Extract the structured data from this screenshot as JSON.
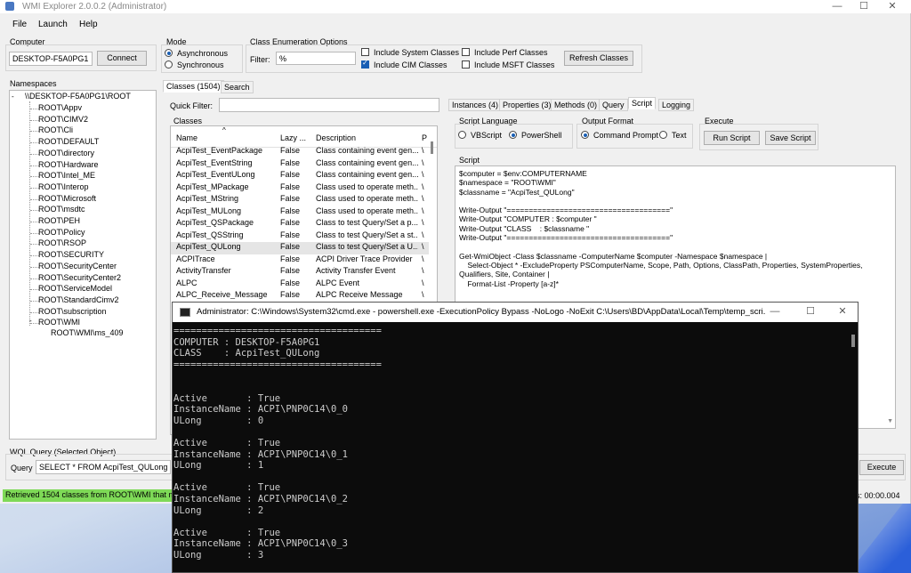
{
  "window": {
    "title": "WMI Explorer 2.0.0.2 (Administrator)",
    "min": "—",
    "max": "☐",
    "close": "✕"
  },
  "menu": [
    "File",
    "Launch",
    "Help"
  ],
  "computer": {
    "label": "Computer",
    "value": "DESKTOP-F5A0PG1",
    "connect": "Connect"
  },
  "mode": {
    "label": "Mode",
    "options": [
      "Asynchronous",
      "Synchronous"
    ],
    "selected": "Asynchronous"
  },
  "enum": {
    "label": "Class Enumeration Options",
    "filter_label": "Filter:",
    "filter_value": "%",
    "checks": [
      {
        "label": "Include System Classes",
        "checked": false
      },
      {
        "label": "Include Perf Classes",
        "checked": false
      },
      {
        "label": "Include CIM Classes",
        "checked": true
      },
      {
        "label": "Include MSFT Classes",
        "checked": false
      }
    ],
    "refresh": "Refresh Classes"
  },
  "namespaces": {
    "label": "Namespaces",
    "root": "\\\\DESKTOP-F5A0PG1\\ROOT",
    "collapse": "-",
    "items": [
      "ROOT\\Appv",
      "ROOT\\CIMV2",
      "ROOT\\Cli",
      "ROOT\\DEFAULT",
      "ROOT\\directory",
      "ROOT\\Hardware",
      "ROOT\\Intel_ME",
      "ROOT\\Interop",
      "ROOT\\Microsoft",
      "ROOT\\msdtc",
      "ROOT\\PEH",
      "ROOT\\Policy",
      "ROOT\\RSOP",
      "ROOT\\SECURITY",
      "ROOT\\SecurityCenter",
      "ROOT\\SecurityCenter2",
      "ROOT\\ServiceModel",
      "ROOT\\StandardCimv2",
      "ROOT\\subscription",
      "ROOT\\WMI"
    ],
    "child": "ROOT\\WMI\\ms_409"
  },
  "class_tabs": [
    "Classes (1504)",
    "Search"
  ],
  "quick_filter": {
    "label": "Quick Filter:",
    "value": ""
  },
  "classes": {
    "label": "Classes",
    "columns": [
      "Name",
      "Lazy ...",
      "Description",
      "P"
    ],
    "rows": [
      [
        "AcpiTest_EventPackage",
        "False",
        "Class containing event gen...",
        "\\"
      ],
      [
        "AcpiTest_EventString",
        "False",
        "Class containing event gen...",
        "\\"
      ],
      [
        "AcpiTest_EventULong",
        "False",
        "Class containing event gen...",
        "\\"
      ],
      [
        "AcpiTest_MPackage",
        "False",
        "Class used to operate meth...",
        "\\"
      ],
      [
        "AcpiTest_MString",
        "False",
        "Class used to operate meth...",
        "\\"
      ],
      [
        "AcpiTest_MULong",
        "False",
        "Class used to operate meth...",
        "\\"
      ],
      [
        "AcpiTest_QSPackage",
        "False",
        "Class to test Query/Set a p...",
        "\\"
      ],
      [
        "AcpiTest_QSString",
        "False",
        "Class to test Query/Set a st...",
        "\\"
      ],
      [
        "AcpiTest_QULong",
        "False",
        "Class to test Query/Set a U...",
        "\\"
      ],
      [
        "ACPITrace",
        "False",
        "ACPI Driver Trace Provider",
        "\\"
      ],
      [
        "ActivityTransfer",
        "False",
        "Activity Transfer Event",
        "\\"
      ],
      [
        "ALPC",
        "False",
        "ALPC Event",
        "\\"
      ],
      [
        "ALPC_Receive_Message",
        "False",
        "ALPC Receive Message",
        "\\"
      ]
    ],
    "selected_index": 8
  },
  "right_tabs": [
    "Instances (4)",
    "Properties (3)",
    "Methods (0)",
    "Query",
    "Script",
    "Logging"
  ],
  "right_active": "Script",
  "script_lang": {
    "label": "Script Language",
    "options": [
      "VBScript",
      "PowerShell"
    ],
    "selected": "PowerShell"
  },
  "output_format": {
    "label": "Output Format",
    "options": [
      "Command Prompt",
      "Text"
    ],
    "selected": "Command Prompt"
  },
  "execute": {
    "label": "Execute",
    "run": "Run Script",
    "save": "Save Script"
  },
  "script": {
    "label": "Script",
    "lines": [
      "$computer = $env:COMPUTERNAME",
      "$namespace = \"ROOT\\WMI\"",
      "$classname = \"AcpiTest_QULong\"",
      "",
      "Write-Output \"=====================================\"",
      "Write-Output \"COMPUTER : $computer \"",
      "Write-Output \"CLASS    : $classname \"",
      "Write-Output \"=====================================\"",
      "",
      "Get-WmiObject -Class $classname -ComputerName $computer -Namespace $namespace |",
      "    Select-Object * -ExcludeProperty PSComputerName, Scope, Path, Options, ClassPath, Properties, SystemProperties,",
      "Qualifiers, Site, Container |",
      "    Format-List -Property [a-z]*"
    ]
  },
  "wql": {
    "label": "WQL Query (Selected Object)",
    "query_label": "Query",
    "value": "SELECT * FROM AcpiTest_QULong",
    "execute": "Execute"
  },
  "status": {
    "text": "Retrieved 1504 classes from ROOT\\WMI that m",
    "timing": "s: 00:00.004"
  },
  "cmd": {
    "title": "Administrator: C:\\Windows\\System32\\cmd.exe - powershell.exe  -ExecutionPolicy Bypass -NoLogo -NoExit C:\\Users\\BD\\AppData\\Local\\Temp\\temp_scri...",
    "lines": [
      "=====================================",
      "COMPUTER : DESKTOP-F5A0PG1",
      "CLASS    : AcpiTest_QULong",
      "=====================================",
      "",
      "",
      "Active       : True",
      "InstanceName : ACPI\\PNP0C14\\0_0",
      "ULong        : 0",
      "",
      "Active       : True",
      "InstanceName : ACPI\\PNP0C14\\0_1",
      "ULong        : 1",
      "",
      "Active       : True",
      "InstanceName : ACPI\\PNP0C14\\0_2",
      "ULong        : 2",
      "",
      "Active       : True",
      "InstanceName : ACPI\\PNP0C14\\0_3",
      "ULong        : 3"
    ]
  }
}
